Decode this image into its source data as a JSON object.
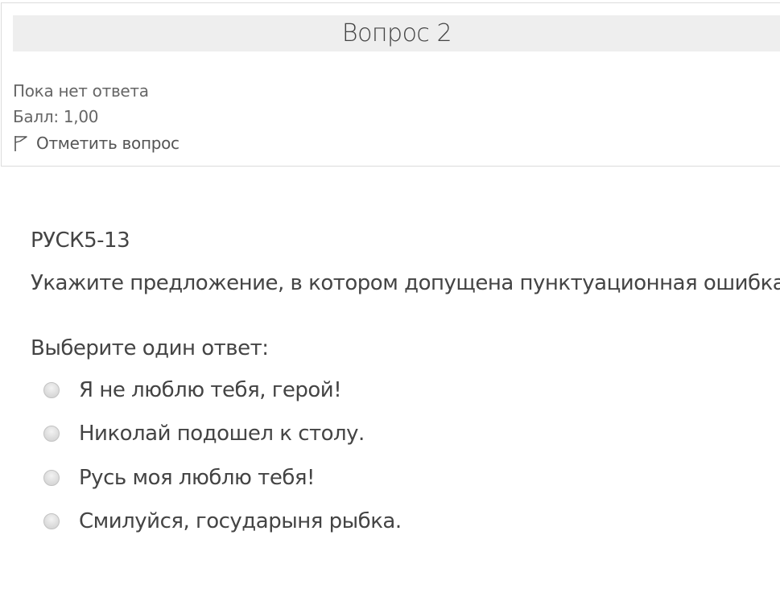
{
  "info": {
    "title": "Вопрос 2",
    "state": "Пока нет ответа",
    "grade": "Балл: 1,00",
    "flag_label": "Отметить вопрос"
  },
  "question": {
    "code": "РУСК5-13",
    "text": "Укажите предложение, в котором допущена пунктуационная ошибка.",
    "prompt": "Выберите один ответ:",
    "answers": [
      {
        "label": "Я не люблю тебя, герой!"
      },
      {
        "label": "Николай подошел к столу."
      },
      {
        "label": "Русь моя люблю тебя!"
      },
      {
        "label": "Смилуйся, государыня рыбка."
      }
    ]
  },
  "icons": {
    "flag": "flag-icon",
    "radio": "radio-button"
  },
  "colors": {
    "title_bar": "#eeeeee",
    "text": "#444444",
    "muted_text": "#666666",
    "border": "#dcdcdc"
  }
}
